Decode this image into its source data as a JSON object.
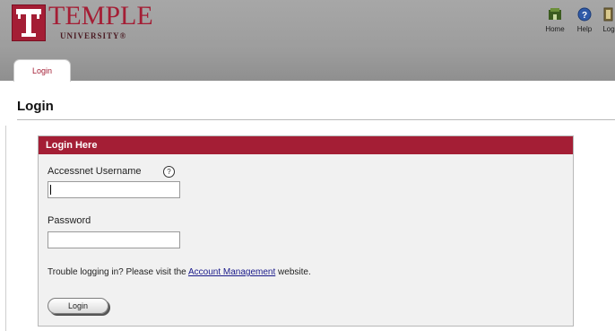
{
  "brand": {
    "name": "TEMPLE",
    "sub": "UNIVERSITY®",
    "mark": "T",
    "color": "#a41e35"
  },
  "toolbar": {
    "items": [
      {
        "label": "Home",
        "icon": "home-icon"
      },
      {
        "label": "Help",
        "icon": "help-icon"
      },
      {
        "label": "Log",
        "icon": "logout-icon"
      }
    ]
  },
  "tab": {
    "label": "Login"
  },
  "page": {
    "title": "Login"
  },
  "panel": {
    "header": "Login Here",
    "header_color": "#a41e35",
    "username_label": "Accessnet Username",
    "username_value": "",
    "help_glyph": "?",
    "password_label": "Password",
    "password_value": "",
    "trouble_prefix": "Trouble logging in? Please visit the",
    "trouble_link": "Account Management",
    "trouble_suffix": "website.",
    "login_button": "Login"
  }
}
